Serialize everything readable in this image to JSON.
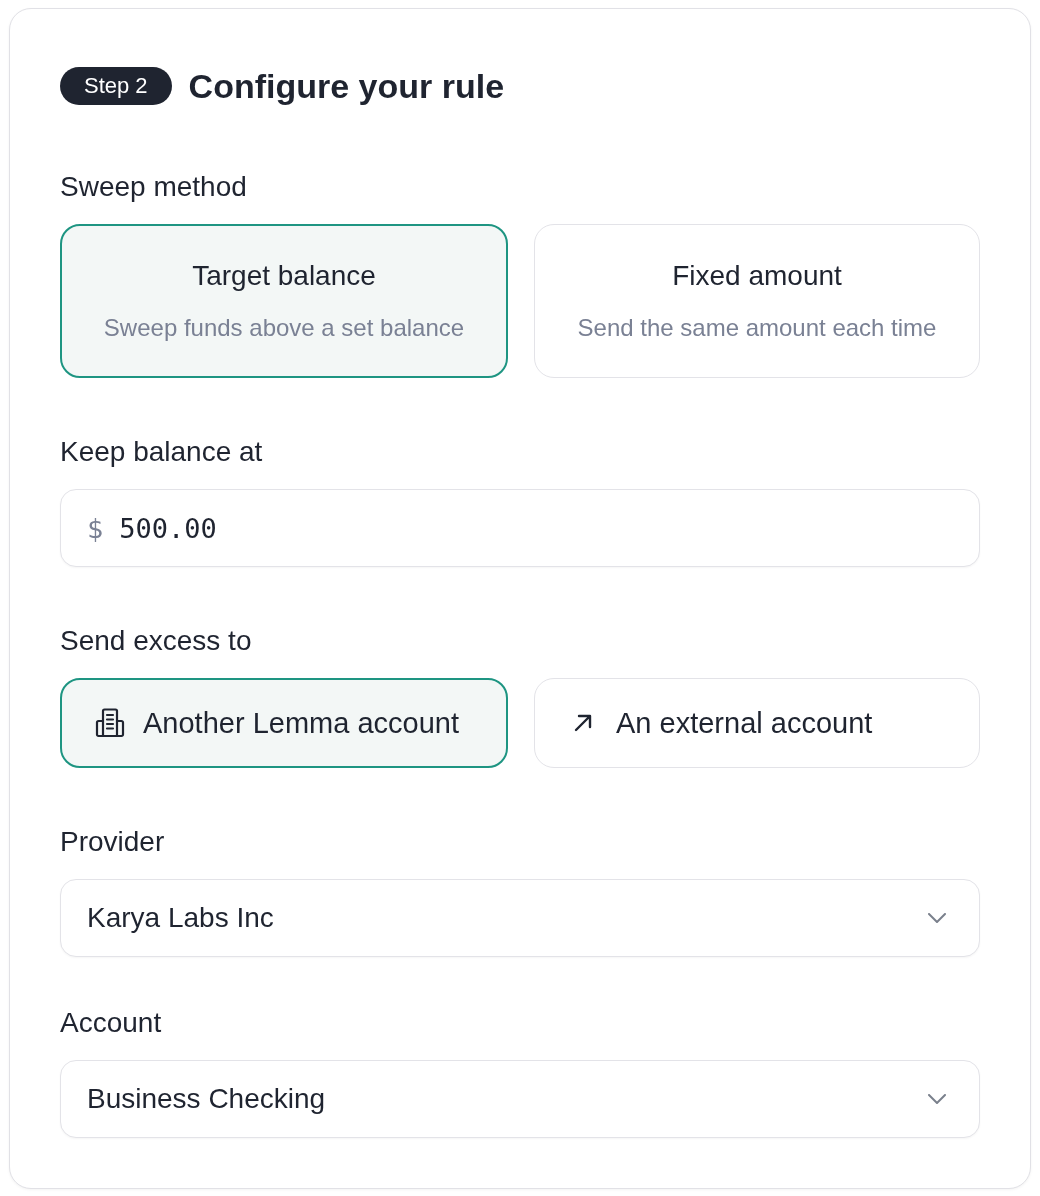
{
  "header": {
    "step_badge": "Step 2",
    "title": "Configure your rule"
  },
  "sweep_method": {
    "label": "Sweep method",
    "options": [
      {
        "title": "Target balance",
        "description": "Sweep funds above a set balance",
        "selected": true
      },
      {
        "title": "Fixed amount",
        "description": "Send the same amount each time",
        "selected": false
      }
    ]
  },
  "keep_balance": {
    "label": "Keep balance at",
    "currency": "$",
    "value": "500.00"
  },
  "send_excess": {
    "label": "Send excess to",
    "options": [
      {
        "label": "Another Lemma account",
        "kind": "internal",
        "selected": true
      },
      {
        "label": "An external account",
        "kind": "external",
        "selected": false
      }
    ]
  },
  "selects": [
    {
      "label": "Provider",
      "value": "Karya Labs Inc"
    },
    {
      "label": "Account",
      "value": "Business Checking"
    }
  ]
}
